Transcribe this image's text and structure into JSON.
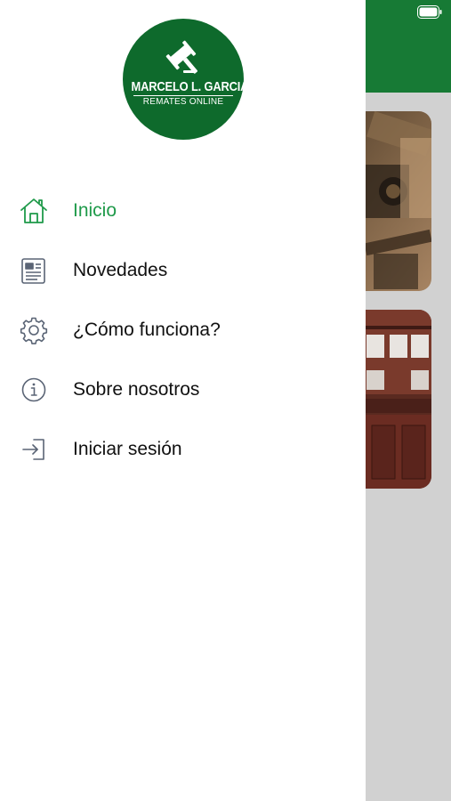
{
  "brand": {
    "name": "MARCELO L. GARCIA",
    "tagline": "REMATES ONLINE",
    "logo_icon": "gavel-icon",
    "logo_color": "#0e6a2c"
  },
  "colors": {
    "accent": "#1f9a4a",
    "header": "#177a35",
    "text": "#111111",
    "icon": "#5a6475"
  },
  "menu": {
    "items": [
      {
        "label": "Inicio",
        "icon": "home-icon",
        "active": true
      },
      {
        "label": "Novedades",
        "icon": "newspaper-icon",
        "active": false
      },
      {
        "label": "¿Cómo funciona?",
        "icon": "gear-icon",
        "active": false
      },
      {
        "label": "Sobre nosotros",
        "icon": "info-icon",
        "active": false
      },
      {
        "label": "Iniciar sesión",
        "icon": "sign-in-icon",
        "active": false
      }
    ]
  },
  "status_bar": {
    "battery_icon": "battery-icon"
  }
}
